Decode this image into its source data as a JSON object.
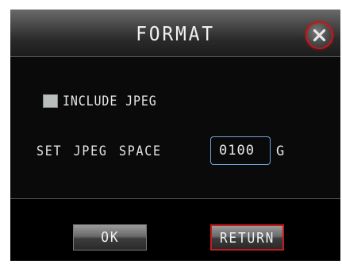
{
  "dialog": {
    "title": "FORMAT",
    "close_icon": "close-x-icon"
  },
  "include_jpeg": {
    "label": "INCLUDE JPEG",
    "checked": false
  },
  "jpeg_space": {
    "label": "SET JPEG SPACE",
    "value": "0100",
    "unit": "G"
  },
  "buttons": {
    "ok_label": "OK",
    "return_label": "RETURN"
  },
  "colors": {
    "focus_accent": "#c41c1c",
    "input_border": "#6fa0d8"
  }
}
